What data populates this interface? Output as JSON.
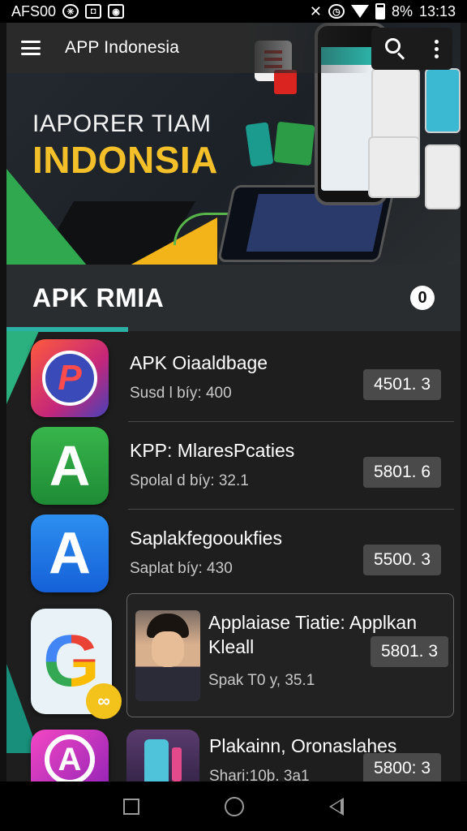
{
  "status_bar": {
    "carrier": "AFS00",
    "battery": "8%",
    "time": "13:13",
    "icons": [
      "settings-icon",
      "notification-icon",
      "camera-icon",
      "mute-icon",
      "alarm-icon",
      "wifi-icon",
      "signal-icon",
      "battery-icon"
    ]
  },
  "app_bar": {
    "title": "APP Indonesia",
    "icons": [
      "menu-icon",
      "search-icon",
      "more-icon"
    ]
  },
  "banner": {
    "subtitle": "IAPORER TIAM",
    "title": "INDONSIA",
    "colors": {
      "title": "#f4c02a",
      "green": "#2fa84f",
      "yellow": "#f2b418"
    }
  },
  "section": {
    "title": "APK RMIA",
    "badge": "0",
    "accent": "#2bb0a6"
  },
  "apps": [
    {
      "name": "APK Oiaaldbage",
      "sub": "Susd l bíy: 400",
      "price": "4501. 3",
      "icon": "red-app-icon"
    },
    {
      "name": "KPP: MlaresPcaties",
      "sub": "Spolal d bíy: 32.1",
      "price": "5801. 6",
      "icon": "green-a-app-icon"
    },
    {
      "name": "Saplakfegooukfies",
      "sub": "Saplat bíy: 430",
      "price": "5500. 3",
      "icon": "blue-a-app-icon"
    }
  ],
  "featured": {
    "name": "Applaiase Tiatie: Applkan Kleall",
    "sub": "Spak T0 y, 35.1",
    "price": "5801. 3",
    "icon": "google-g-app-icon"
  },
  "last_app": {
    "name": "Plakainn, Oronaslahes",
    "sub": "Shari:10þ. 3a1",
    "price": "5800: 3",
    "icon": "pink-a-app-icon"
  },
  "nav": [
    "recents-icon",
    "home-icon",
    "back-icon"
  ]
}
